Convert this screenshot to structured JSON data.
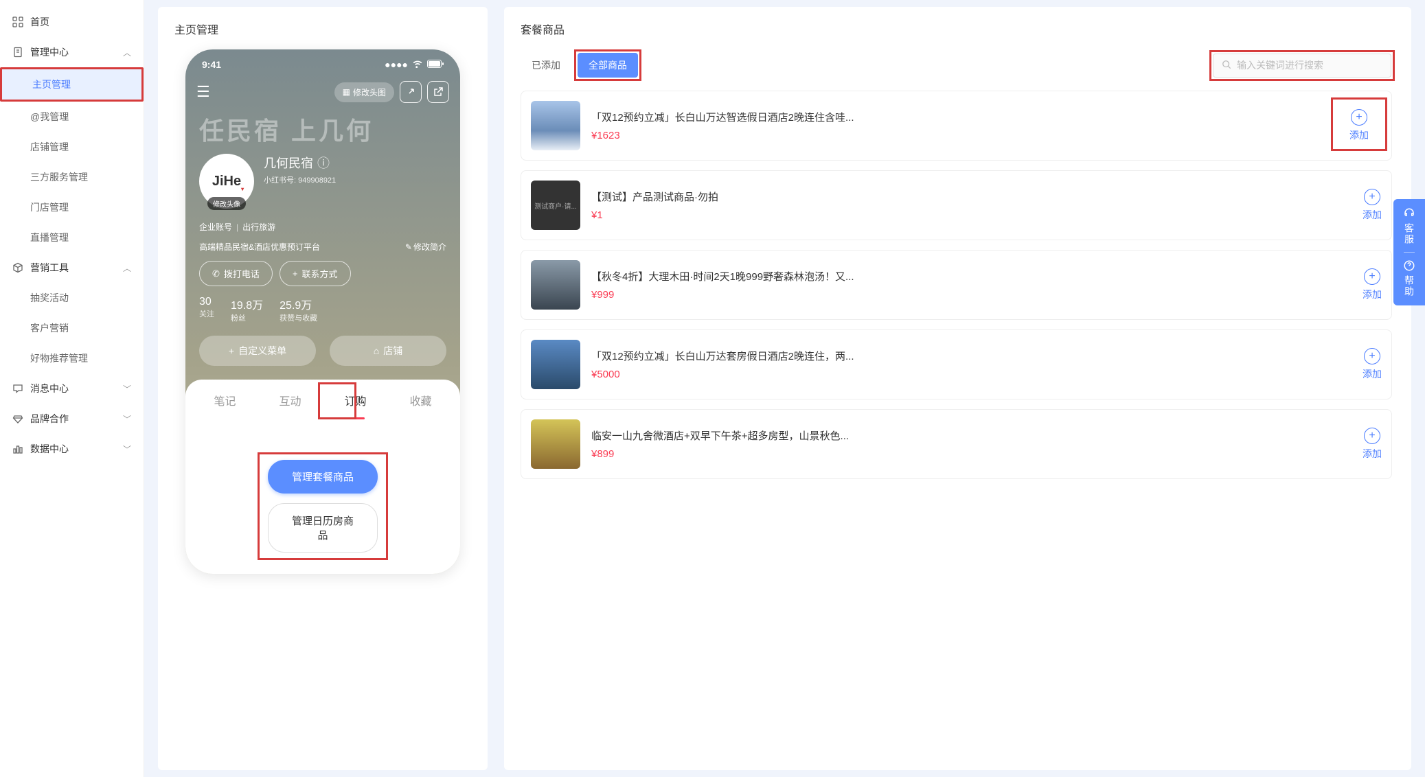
{
  "sidebar": {
    "home": "首页",
    "groups": [
      {
        "label": "管理中心",
        "expanded": true,
        "items": [
          {
            "label": "主页管理",
            "active": true
          },
          {
            "label": "@我管理"
          },
          {
            "label": "店铺管理"
          },
          {
            "label": "三方服务管理"
          },
          {
            "label": "门店管理"
          },
          {
            "label": "直播管理"
          }
        ]
      },
      {
        "label": "营销工具",
        "expanded": true,
        "items": [
          {
            "label": "抽奖活动"
          },
          {
            "label": "客户营销"
          },
          {
            "label": "好物推荐管理"
          }
        ]
      },
      {
        "label": "消息中心",
        "expanded": false,
        "items": []
      },
      {
        "label": "品牌合作",
        "expanded": false,
        "items": []
      },
      {
        "label": "数据中心",
        "expanded": false,
        "items": []
      }
    ]
  },
  "panel_left": {
    "title": "主页管理",
    "phone": {
      "time": "9:41",
      "edit_header_btn": "修改头图",
      "hero": "任民宿 上几何",
      "avatar_text": "JiHe",
      "avatar_label": "修改头像",
      "profile_name": "几何民宿",
      "profile_id": "小红书号: 949908921",
      "tag1": "企业账号",
      "tag2": "出行旅游",
      "description": "高端精品民宿&酒店优惠预订平台",
      "edit_intro": "修改简介",
      "call_btn": "拨打电话",
      "contact_btn": "联系方式",
      "stats": [
        {
          "num": "30",
          "label": "关注"
        },
        {
          "num": "19.8万",
          "label": "粉丝"
        },
        {
          "num": "25.9万",
          "label": "获赞与收藏"
        }
      ],
      "custom_menu_btn": "自定义菜单",
      "shop_btn": "店铺",
      "tabs": [
        {
          "label": "笔记"
        },
        {
          "label": "互动"
        },
        {
          "label": "订购",
          "active": true
        },
        {
          "label": "收藏"
        }
      ],
      "manage_package_btn": "管理套餐商品",
      "manage_calendar_btn": "管理日历房商品"
    }
  },
  "panel_right": {
    "title": "套餐商品",
    "filter_added": "已添加",
    "filter_all": "全部商品",
    "search_placeholder": "输入关键词进行搜索",
    "action_add": "添加",
    "products": [
      {
        "title": "「双12预约立减」长白山万达智选假日酒店2晚连住含哇...",
        "price": "¥1623",
        "img_class": "img-hotel",
        "highlighted": true
      },
      {
        "title": "【测试】产品测试商品·勿拍",
        "price": "¥1",
        "img_class": "img-test",
        "img_text": "测试商户·请..."
      },
      {
        "title": "【秋冬4折】大理木田·时间2天1晚999野奢森林泡汤！又...",
        "price": "¥999",
        "img_class": "img-dali"
      },
      {
        "title": "「双12预约立减」长白山万达套房假日酒店2晚连住，两...",
        "price": "¥5000",
        "img_class": "img-snow"
      },
      {
        "title": "临安一山九舍微酒店+双早下午茶+超多房型，山景秋色...",
        "price": "¥899",
        "img_class": "img-autumn"
      }
    ]
  },
  "help_dock": {
    "service": "客服",
    "help": "帮助"
  }
}
